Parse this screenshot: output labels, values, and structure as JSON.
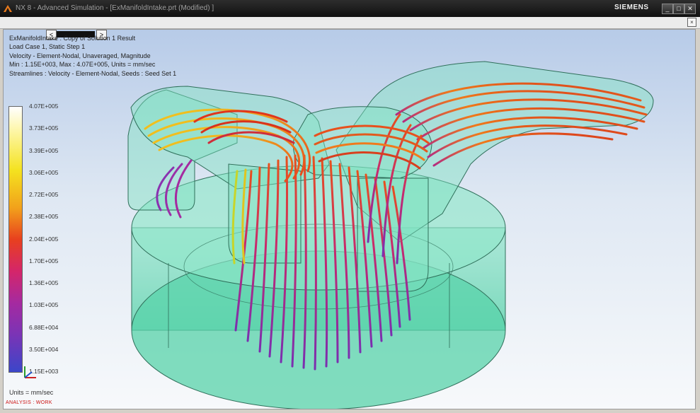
{
  "window": {
    "title": "NX 8 - Advanced Simulation - [ExManifoldIntake.prt (Modified) ]",
    "brand": "SIEMENS",
    "buttons": {
      "minimize": "_",
      "maximize": "□",
      "close": "✕"
    }
  },
  "subbar": {
    "close_glyph": "×"
  },
  "navigator": {
    "prev": "<",
    "next": ">"
  },
  "info": {
    "lines": [
      "ExManifoldIntake : Copy of Solution 1 Result",
      "Load Case 1, Static Step 1",
      "Velocity - Element-Nodal, Unaveraged, Magnitude",
      "Min : 1.15E+003, Max : 4.07E+005, Units = mm/sec",
      "Streamlines : Velocity - Element-Nodal, Seeds : Seed Set 1"
    ]
  },
  "legend": {
    "labels": [
      "4.07E+005",
      "3.73E+005",
      "3.39E+005",
      "3.06E+005",
      "2.72E+005",
      "2.38E+005",
      "2.04E+005",
      "1.70E+005",
      "1.36E+005",
      "1.03E+005",
      "6.88E+004",
      "3.50E+004",
      "1.15E+003"
    ],
    "units": "Units = mm/sec",
    "colors_top_to_bottom": [
      "#ffffff",
      "#fdf59e",
      "#f4e21f",
      "#f2a21b",
      "#e8401e",
      "#d4266a",
      "#a52aa0",
      "#7a34b6",
      "#3b46c9"
    ]
  },
  "status": {
    "mode": "ANALYSIS : WORK"
  },
  "icons": {
    "app_logo": "nx-logo-icon",
    "triad": "coordinate-triad-icon"
  },
  "colors": {
    "housing": "#5fd7b0",
    "housing_edge": "#2f6f5a",
    "stream_low": "#7a2fb0",
    "stream_mid": "#e8321c",
    "stream_high": "#f3d21e"
  }
}
